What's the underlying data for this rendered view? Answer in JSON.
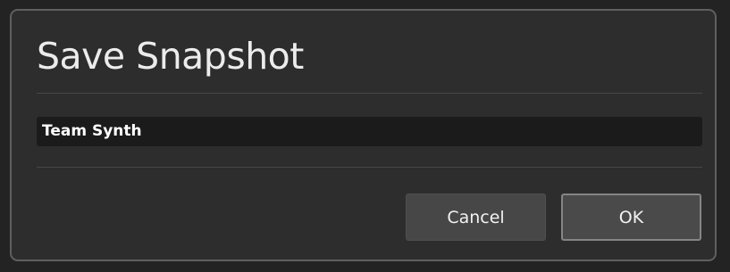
{
  "dialog": {
    "title": "Save Snapshot",
    "name_input": {
      "value": "Team Synth",
      "placeholder": ""
    },
    "cancel_label": "Cancel",
    "ok_label": "OK"
  },
  "colors": {
    "dialog_background": "#2d2d2d",
    "dialog_border": "#5f5f5f",
    "input_background": "#1b1b1b",
    "button_background": "#474747",
    "ok_button_border": "#858585",
    "text": "#ececec"
  }
}
